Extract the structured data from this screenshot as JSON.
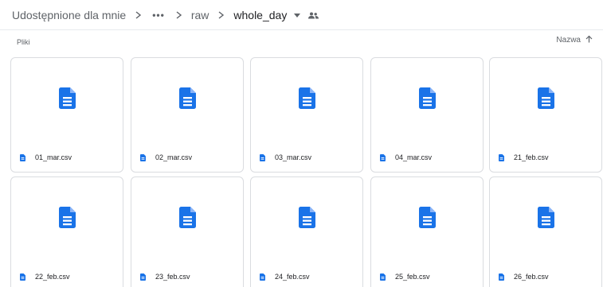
{
  "breadcrumb": {
    "root": "Udostępnione dla mnie",
    "more": "•••",
    "parent": "raw",
    "current": "whole_day"
  },
  "icons": {
    "separator": "chevron-right-icon",
    "folder_menu": "caret-down-icon",
    "shared": "shared-people-icon",
    "file": "google-docs-file-icon",
    "sort": "arrow-up-icon"
  },
  "section": {
    "label": "Pliki",
    "sort_label": "Nazwa"
  },
  "colors": {
    "file_icon_blue": "#1a73e8",
    "card_border": "#dadce0",
    "text_primary": "#202124",
    "text_secondary": "#5f6368"
  },
  "files": [
    {
      "name": "01_mar.csv"
    },
    {
      "name": "02_mar.csv"
    },
    {
      "name": "03_mar.csv"
    },
    {
      "name": "04_mar.csv"
    },
    {
      "name": "21_feb.csv"
    },
    {
      "name": "22_feb.csv"
    },
    {
      "name": "23_feb.csv"
    },
    {
      "name": "24_feb.csv"
    },
    {
      "name": "25_feb.csv"
    },
    {
      "name": "26_feb.csv"
    }
  ]
}
